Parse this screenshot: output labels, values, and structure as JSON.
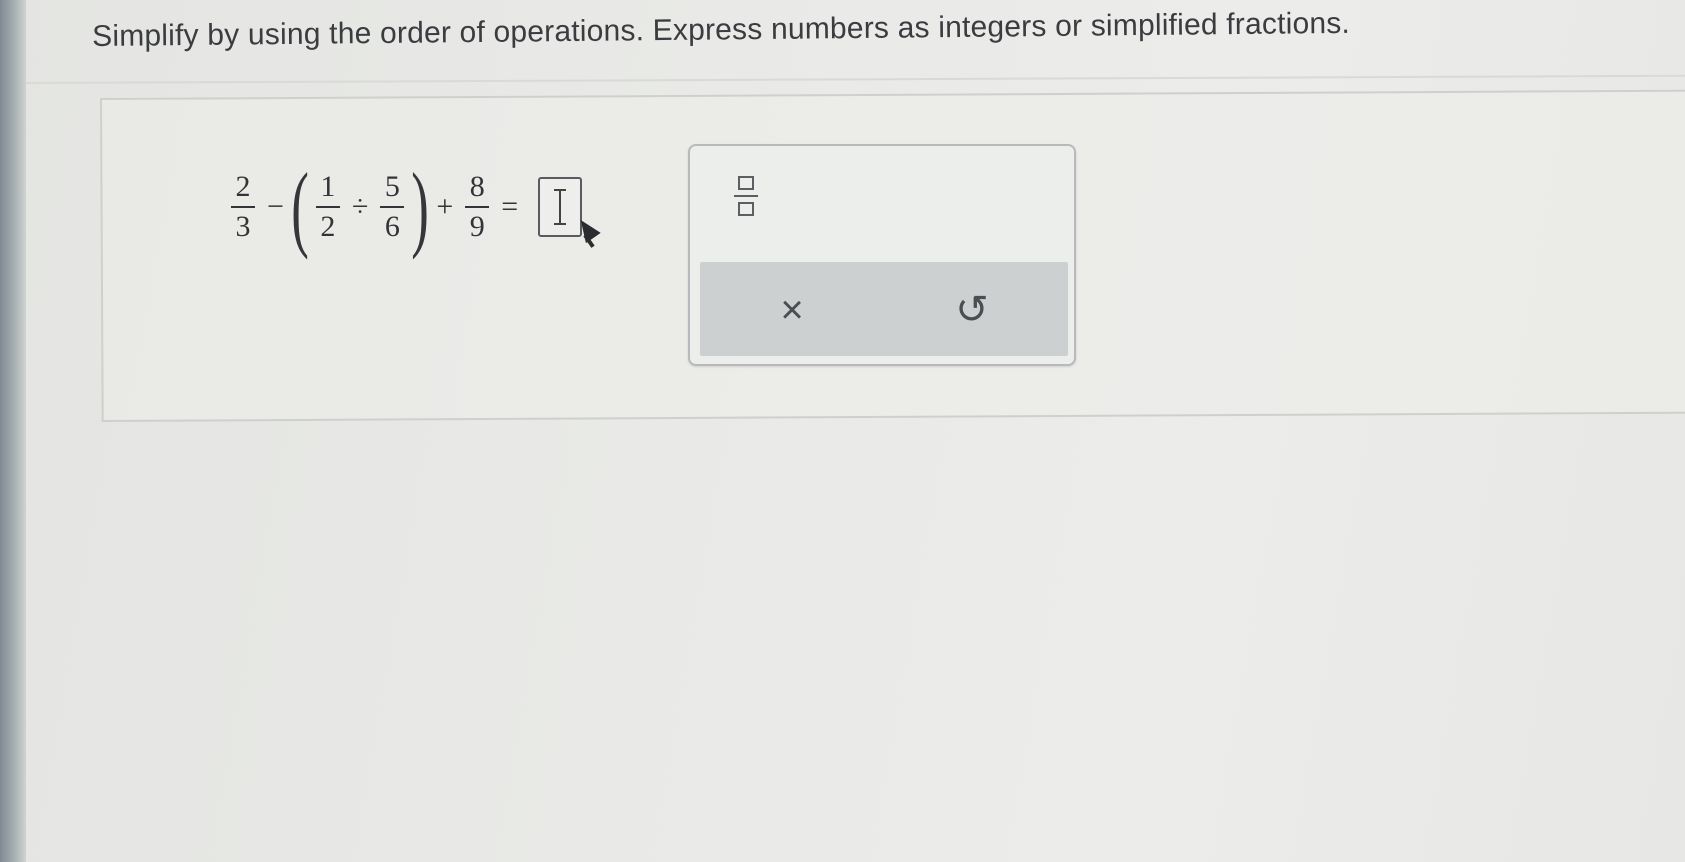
{
  "instruction": "Simplify by using the order of operations. Express numbers as integers or simplified fractions.",
  "expression": {
    "frac1": {
      "numerator": "2",
      "denominator": "3"
    },
    "op_minus": "−",
    "frac2": {
      "numerator": "1",
      "denominator": "2"
    },
    "op_divide": "÷",
    "frac3": {
      "numerator": "5",
      "denominator": "6"
    },
    "op_plus": "+",
    "frac4": {
      "numerator": "8",
      "denominator": "9"
    },
    "op_equals": "=",
    "paren_open": "(",
    "paren_close": ")"
  },
  "answer": {
    "value": ""
  },
  "palette": {
    "fraction_tool_icon": "fraction-template-icon",
    "clear_label": "×",
    "undo_label": "↺"
  }
}
